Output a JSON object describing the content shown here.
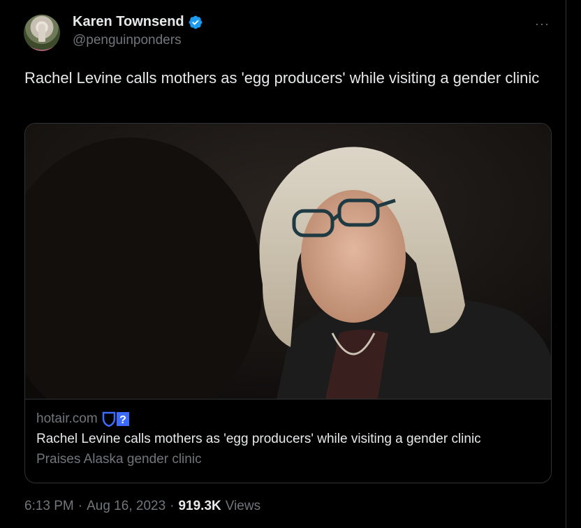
{
  "author": {
    "name": "Karen Townsend",
    "handle": "@penguinponders",
    "verified_icon": "verified-badge-icon",
    "verified_color": "#1d9bf0"
  },
  "menu": {
    "more_label": "···"
  },
  "tweet": {
    "text": "Rachel Levine calls mothers as 'egg producers' while visiting a gender clinic"
  },
  "card": {
    "domain": "hotair.com",
    "domain_badge_icon": "shield-question-icon",
    "title": "Rachel Levine calls mothers as 'egg producers' while visiting a gender clinic",
    "description": "Praises Alaska gender clinic"
  },
  "meta": {
    "time": "6:13 PM",
    "separator": "·",
    "date": "Aug 16, 2023",
    "views_count": "919.3K",
    "views_label": "Views"
  },
  "colors": {
    "background": "#000000",
    "text_primary": "#e7e9ea",
    "text_secondary": "#71767b",
    "border": "#2f3336",
    "accent": "#1d9bf0"
  }
}
